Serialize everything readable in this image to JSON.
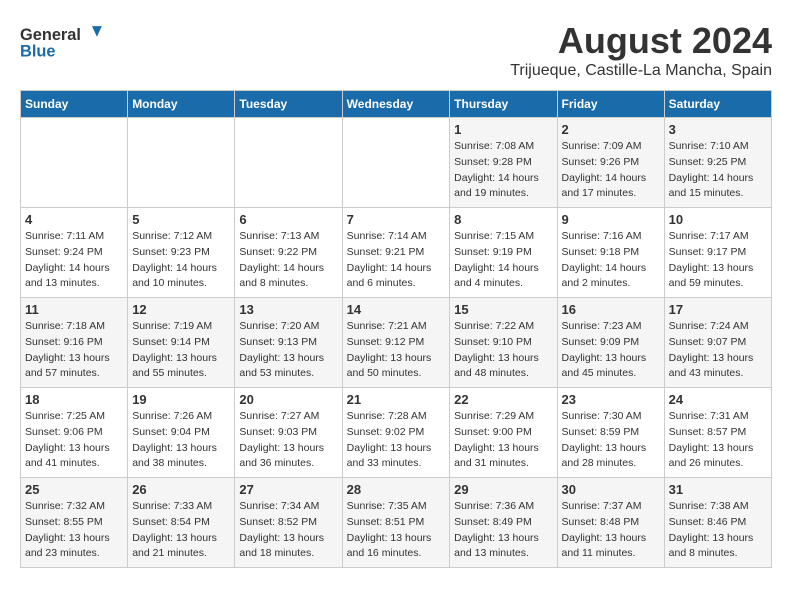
{
  "header": {
    "logo_general": "General",
    "logo_blue": "Blue",
    "month_title": "August 2024",
    "location": "Trijueque, Castille-La Mancha, Spain"
  },
  "weekdays": [
    "Sunday",
    "Monday",
    "Tuesday",
    "Wednesday",
    "Thursday",
    "Friday",
    "Saturday"
  ],
  "weeks": [
    [
      {
        "day": "",
        "sunrise": "",
        "sunset": "",
        "daylight": ""
      },
      {
        "day": "",
        "sunrise": "",
        "sunset": "",
        "daylight": ""
      },
      {
        "day": "",
        "sunrise": "",
        "sunset": "",
        "daylight": ""
      },
      {
        "day": "",
        "sunrise": "",
        "sunset": "",
        "daylight": ""
      },
      {
        "day": "1",
        "sunrise": "Sunrise: 7:08 AM",
        "sunset": "Sunset: 9:28 PM",
        "daylight": "Daylight: 14 hours and 19 minutes."
      },
      {
        "day": "2",
        "sunrise": "Sunrise: 7:09 AM",
        "sunset": "Sunset: 9:26 PM",
        "daylight": "Daylight: 14 hours and 17 minutes."
      },
      {
        "day": "3",
        "sunrise": "Sunrise: 7:10 AM",
        "sunset": "Sunset: 9:25 PM",
        "daylight": "Daylight: 14 hours and 15 minutes."
      }
    ],
    [
      {
        "day": "4",
        "sunrise": "Sunrise: 7:11 AM",
        "sunset": "Sunset: 9:24 PM",
        "daylight": "Daylight: 14 hours and 13 minutes."
      },
      {
        "day": "5",
        "sunrise": "Sunrise: 7:12 AM",
        "sunset": "Sunset: 9:23 PM",
        "daylight": "Daylight: 14 hours and 10 minutes."
      },
      {
        "day": "6",
        "sunrise": "Sunrise: 7:13 AM",
        "sunset": "Sunset: 9:22 PM",
        "daylight": "Daylight: 14 hours and 8 minutes."
      },
      {
        "day": "7",
        "sunrise": "Sunrise: 7:14 AM",
        "sunset": "Sunset: 9:21 PM",
        "daylight": "Daylight: 14 hours and 6 minutes."
      },
      {
        "day": "8",
        "sunrise": "Sunrise: 7:15 AM",
        "sunset": "Sunset: 9:19 PM",
        "daylight": "Daylight: 14 hours and 4 minutes."
      },
      {
        "day": "9",
        "sunrise": "Sunrise: 7:16 AM",
        "sunset": "Sunset: 9:18 PM",
        "daylight": "Daylight: 14 hours and 2 minutes."
      },
      {
        "day": "10",
        "sunrise": "Sunrise: 7:17 AM",
        "sunset": "Sunset: 9:17 PM",
        "daylight": "Daylight: 13 hours and 59 minutes."
      }
    ],
    [
      {
        "day": "11",
        "sunrise": "Sunrise: 7:18 AM",
        "sunset": "Sunset: 9:16 PM",
        "daylight": "Daylight: 13 hours and 57 minutes."
      },
      {
        "day": "12",
        "sunrise": "Sunrise: 7:19 AM",
        "sunset": "Sunset: 9:14 PM",
        "daylight": "Daylight: 13 hours and 55 minutes."
      },
      {
        "day": "13",
        "sunrise": "Sunrise: 7:20 AM",
        "sunset": "Sunset: 9:13 PM",
        "daylight": "Daylight: 13 hours and 53 minutes."
      },
      {
        "day": "14",
        "sunrise": "Sunrise: 7:21 AM",
        "sunset": "Sunset: 9:12 PM",
        "daylight": "Daylight: 13 hours and 50 minutes."
      },
      {
        "day": "15",
        "sunrise": "Sunrise: 7:22 AM",
        "sunset": "Sunset: 9:10 PM",
        "daylight": "Daylight: 13 hours and 48 minutes."
      },
      {
        "day": "16",
        "sunrise": "Sunrise: 7:23 AM",
        "sunset": "Sunset: 9:09 PM",
        "daylight": "Daylight: 13 hours and 45 minutes."
      },
      {
        "day": "17",
        "sunrise": "Sunrise: 7:24 AM",
        "sunset": "Sunset: 9:07 PM",
        "daylight": "Daylight: 13 hours and 43 minutes."
      }
    ],
    [
      {
        "day": "18",
        "sunrise": "Sunrise: 7:25 AM",
        "sunset": "Sunset: 9:06 PM",
        "daylight": "Daylight: 13 hours and 41 minutes."
      },
      {
        "day": "19",
        "sunrise": "Sunrise: 7:26 AM",
        "sunset": "Sunset: 9:04 PM",
        "daylight": "Daylight: 13 hours and 38 minutes."
      },
      {
        "day": "20",
        "sunrise": "Sunrise: 7:27 AM",
        "sunset": "Sunset: 9:03 PM",
        "daylight": "Daylight: 13 hours and 36 minutes."
      },
      {
        "day": "21",
        "sunrise": "Sunrise: 7:28 AM",
        "sunset": "Sunset: 9:02 PM",
        "daylight": "Daylight: 13 hours and 33 minutes."
      },
      {
        "day": "22",
        "sunrise": "Sunrise: 7:29 AM",
        "sunset": "Sunset: 9:00 PM",
        "daylight": "Daylight: 13 hours and 31 minutes."
      },
      {
        "day": "23",
        "sunrise": "Sunrise: 7:30 AM",
        "sunset": "Sunset: 8:59 PM",
        "daylight": "Daylight: 13 hours and 28 minutes."
      },
      {
        "day": "24",
        "sunrise": "Sunrise: 7:31 AM",
        "sunset": "Sunset: 8:57 PM",
        "daylight": "Daylight: 13 hours and 26 minutes."
      }
    ],
    [
      {
        "day": "25",
        "sunrise": "Sunrise: 7:32 AM",
        "sunset": "Sunset: 8:55 PM",
        "daylight": "Daylight: 13 hours and 23 minutes."
      },
      {
        "day": "26",
        "sunrise": "Sunrise: 7:33 AM",
        "sunset": "Sunset: 8:54 PM",
        "daylight": "Daylight: 13 hours and 21 minutes."
      },
      {
        "day": "27",
        "sunrise": "Sunrise: 7:34 AM",
        "sunset": "Sunset: 8:52 PM",
        "daylight": "Daylight: 13 hours and 18 minutes."
      },
      {
        "day": "28",
        "sunrise": "Sunrise: 7:35 AM",
        "sunset": "Sunset: 8:51 PM",
        "daylight": "Daylight: 13 hours and 16 minutes."
      },
      {
        "day": "29",
        "sunrise": "Sunrise: 7:36 AM",
        "sunset": "Sunset: 8:49 PM",
        "daylight": "Daylight: 13 hours and 13 minutes."
      },
      {
        "day": "30",
        "sunrise": "Sunrise: 7:37 AM",
        "sunset": "Sunset: 8:48 PM",
        "daylight": "Daylight: 13 hours and 11 minutes."
      },
      {
        "day": "31",
        "sunrise": "Sunrise: 7:38 AM",
        "sunset": "Sunset: 8:46 PM",
        "daylight": "Daylight: 13 hours and 8 minutes."
      }
    ]
  ]
}
